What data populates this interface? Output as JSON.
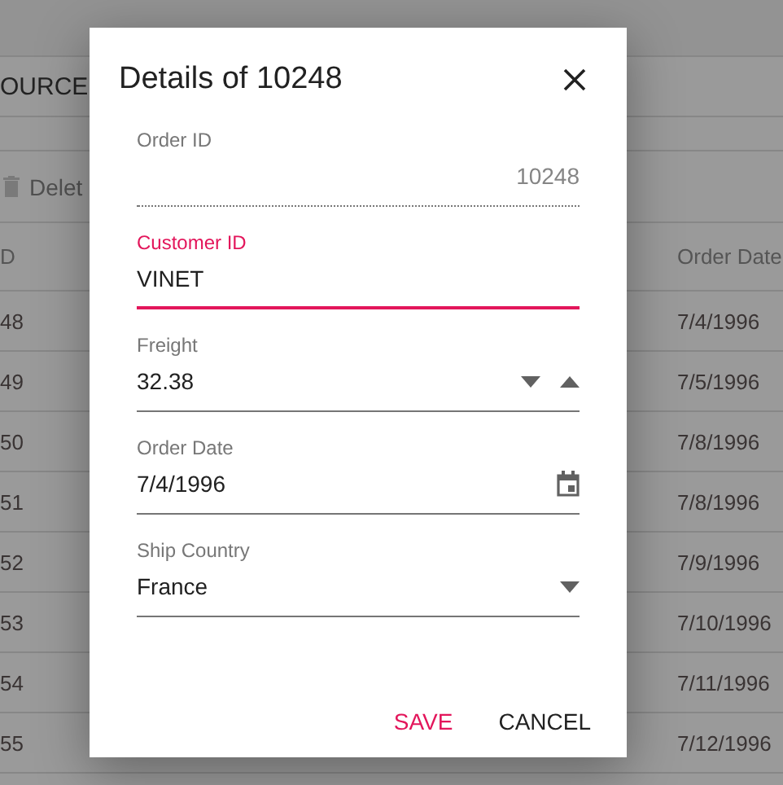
{
  "background": {
    "section_title": "OURCE",
    "toolbar": [
      {
        "label": "Delet",
        "disabled": true
      }
    ],
    "grid": {
      "columns": [
        "D",
        "Order Date"
      ],
      "rows": [
        {
          "cells": [
            "48",
            "7/4/1996"
          ]
        },
        {
          "cells": [
            "49",
            "7/5/1996"
          ]
        },
        {
          "cells": [
            "50",
            "7/8/1996"
          ]
        },
        {
          "cells": [
            "51",
            "7/8/1996"
          ]
        },
        {
          "cells": [
            "52",
            "7/9/1996"
          ]
        },
        {
          "cells": [
            "53",
            "7/10/1996"
          ]
        },
        {
          "cells": [
            "54",
            "7/11/1996"
          ]
        },
        {
          "cells": [
            "55",
            "7/12/1996"
          ]
        }
      ]
    }
  },
  "dialog": {
    "title": "Details of 10248",
    "fields": [
      {
        "kind": "text",
        "label": "Order ID",
        "value": "10248",
        "disabled": true,
        "focused": false
      },
      {
        "kind": "text",
        "label": "Customer ID",
        "value": "VINET",
        "disabled": false,
        "focused": true
      },
      {
        "kind": "numeric",
        "label": "Freight",
        "value": "32.38",
        "disabled": false,
        "focused": false
      },
      {
        "kind": "date",
        "label": "Order Date",
        "value": "7/4/1996",
        "disabled": false,
        "focused": false
      },
      {
        "kind": "dropdown",
        "label": "Ship Country",
        "value": "France",
        "disabled": false,
        "focused": false
      }
    ],
    "buttons": [
      {
        "label": "SAVE",
        "primary": true
      },
      {
        "label": "CANCEL",
        "primary": false
      }
    ]
  }
}
